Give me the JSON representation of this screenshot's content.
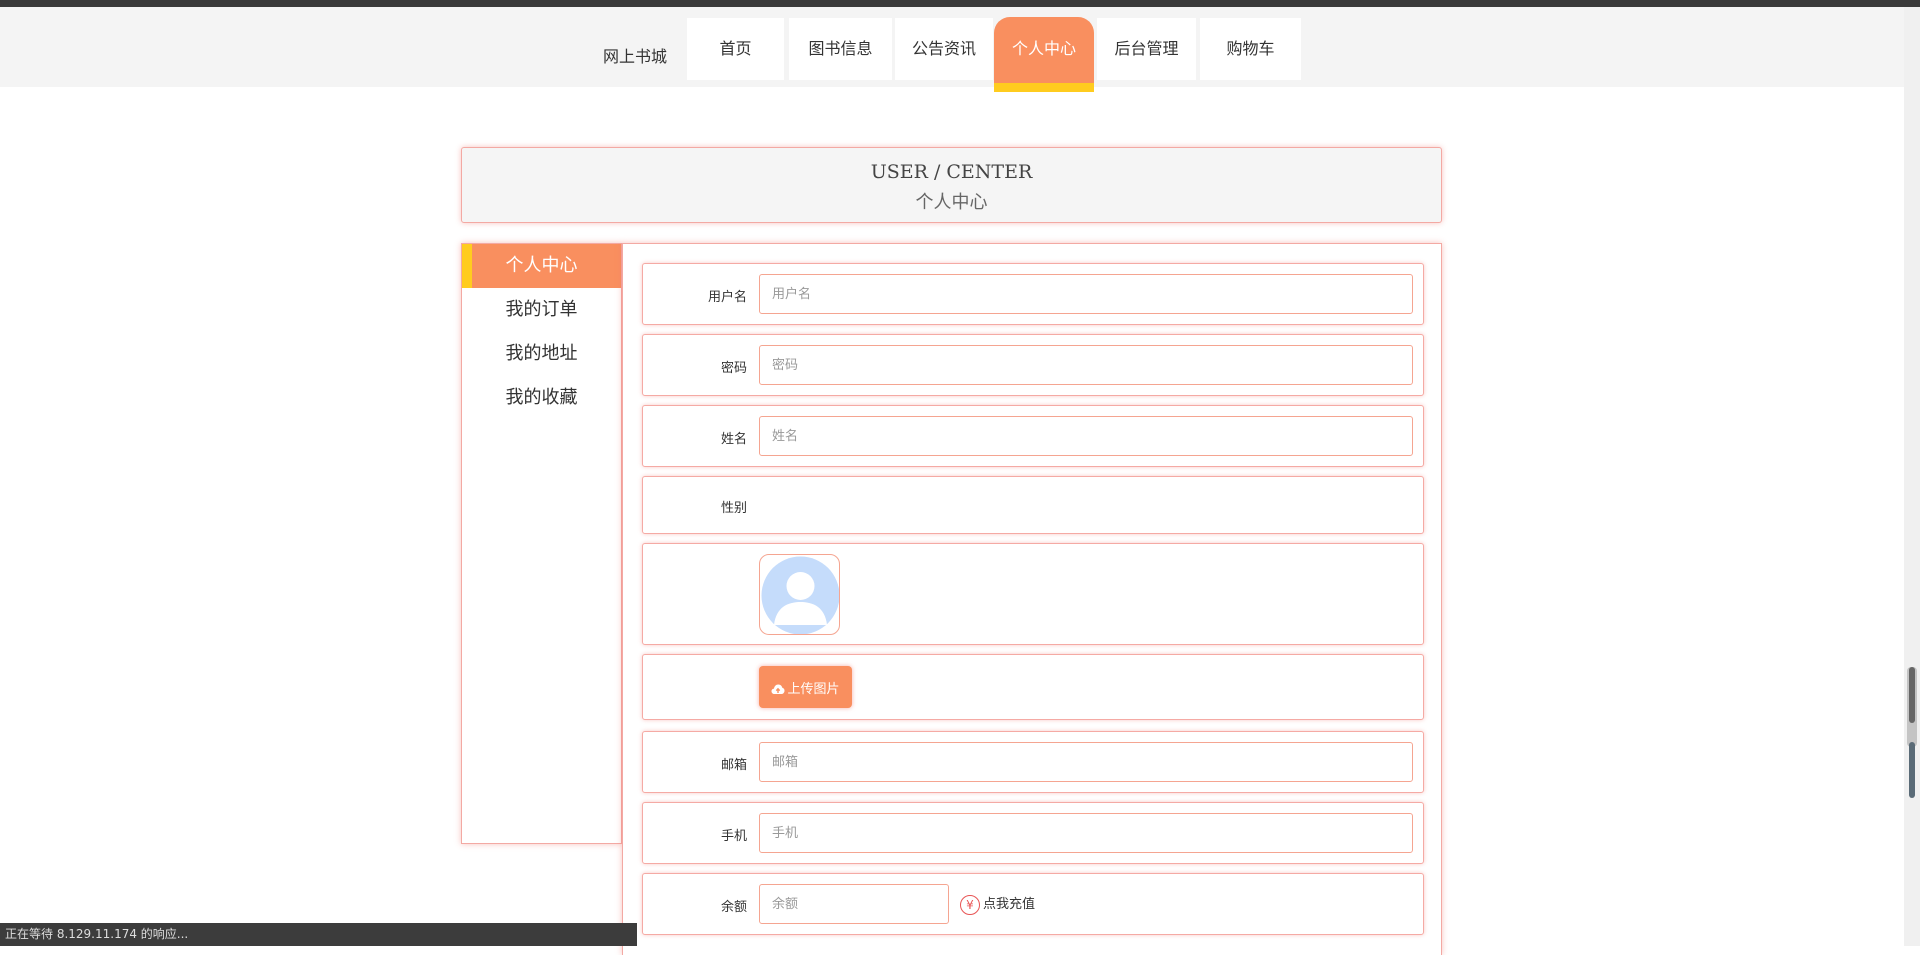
{
  "nav": {
    "brand": "网上书城",
    "items": [
      {
        "label": "首页"
      },
      {
        "label": "图书信息"
      },
      {
        "label": "公告资讯"
      },
      {
        "label": "个人中心",
        "active": true
      },
      {
        "label": "后台管理"
      },
      {
        "label": "购物车"
      }
    ]
  },
  "header": {
    "en": "USER / CENTER",
    "cn": "个人中心"
  },
  "sidebar": {
    "items": [
      {
        "label": "个人中心",
        "active": true
      },
      {
        "label": "我的订单"
      },
      {
        "label": "我的地址"
      },
      {
        "label": "我的收藏"
      }
    ]
  },
  "form": {
    "username": {
      "label": "用户名",
      "placeholder": "用户名"
    },
    "password": {
      "label": "密码",
      "placeholder": "密码"
    },
    "name": {
      "label": "姓名",
      "placeholder": "姓名"
    },
    "gender": {
      "label": "性别"
    },
    "upload_label": "上传图片",
    "email": {
      "label": "邮箱",
      "placeholder": "邮箱"
    },
    "phone": {
      "label": "手机",
      "placeholder": "手机"
    },
    "balance": {
      "label": "余额",
      "placeholder": "余额"
    },
    "recharge_label": "点我充值"
  },
  "status": {
    "text": "正在等待 8.129.11.174 的响应..."
  },
  "colors": {
    "accent": "#f98f5f",
    "highlight": "#ffcc1f",
    "border": "#f3a9a3"
  }
}
